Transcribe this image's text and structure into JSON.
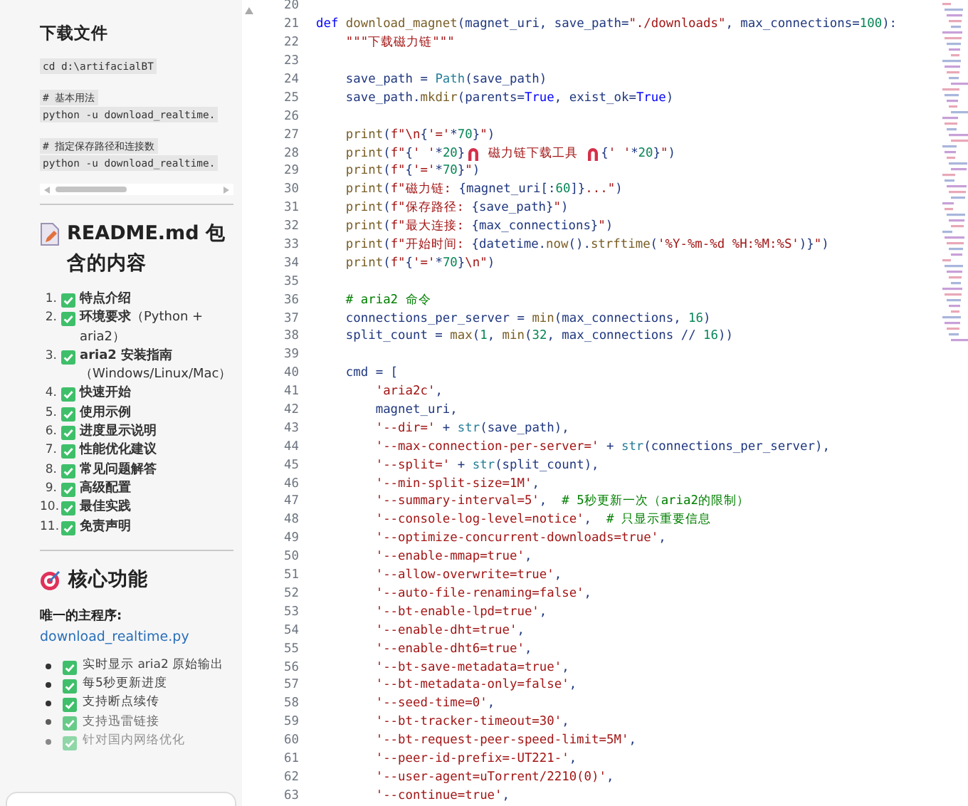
{
  "sidebar": {
    "download_heading": "下载文件",
    "code_blocks": [
      {
        "lines": [
          "cd d:\\artifacialBT"
        ]
      },
      {
        "lines": [
          "# 基本用法",
          "python -u download_realtime."
        ]
      },
      {
        "lines": [
          "# 指定保存路径和连接数",
          "python -u download_realtime."
        ]
      }
    ],
    "readme_heading": "README.md 包含的内容",
    "contents": [
      {
        "number": "1.",
        "text": "**特点介绍**"
      },
      {
        "number": "2.",
        "text": "**环境要求**（Python + aria2）"
      },
      {
        "number": "3.",
        "text": "**aria2 安装指南**（Windows/Linux/Mac）"
      },
      {
        "number": "4.",
        "text": "**快速开始**"
      },
      {
        "number": "5.",
        "text": "**使用示例**"
      },
      {
        "number": "6.",
        "text": "**进度显示说明**"
      },
      {
        "number": "7.",
        "text": "**性能优化建议**"
      },
      {
        "number": "8.",
        "text": "**常见问题解答**"
      },
      {
        "number": "9.",
        "text": "**高级配置**"
      },
      {
        "number": "10.",
        "text": "**最佳实践**"
      },
      {
        "number": "11.",
        "text": "**免责声明**"
      }
    ],
    "core_heading": "核心功能",
    "main_program_label": "唯一的主程序:",
    "main_program_link": "download_realtime.py",
    "features": [
      "实时显示 aria2 原始输出",
      "每5秒更新进度",
      "支持断点续传",
      "支持迅雷链接",
      "针对国内网络优化"
    ]
  },
  "editor": {
    "lines": [
      {
        "number": "20"
      },
      {
        "number": "21",
        "tokens": [
          {
            "kind": "kw",
            "text": "def "
          },
          {
            "kind": "fn",
            "text": "download_magnet"
          },
          {
            "kind": "pl",
            "text": "(magnet_uri, save_path="
          },
          {
            "kind": "str",
            "text": "\"./downloads\""
          },
          {
            "kind": "pl",
            "text": ", max_connections="
          },
          {
            "kind": "num",
            "text": "100"
          },
          {
            "kind": "pl",
            "text": "):"
          }
        ]
      },
      {
        "number": "22",
        "tokens": [
          {
            "kind": "str",
            "text": "    \"\"\"下载磁力链\"\"\""
          }
        ]
      },
      {
        "number": "23"
      },
      {
        "number": "24",
        "tokens": [
          {
            "kind": "pl",
            "text": "    save_path = "
          },
          {
            "kind": "bi",
            "text": "Path"
          },
          {
            "kind": "pl",
            "text": "(save_path)"
          }
        ]
      },
      {
        "number": "25",
        "tokens": [
          {
            "kind": "pl",
            "text": "    save_path."
          },
          {
            "kind": "fn",
            "text": "mkdir"
          },
          {
            "kind": "pl",
            "text": "(parents="
          },
          {
            "kind": "kw",
            "text": "True"
          },
          {
            "kind": "pl",
            "text": ", exist_ok="
          },
          {
            "kind": "kw",
            "text": "True"
          },
          {
            "kind": "pl",
            "text": ")"
          }
        ]
      },
      {
        "number": "26"
      },
      {
        "number": "27",
        "tokens": [
          {
            "kind": "fn",
            "text": "    print"
          },
          {
            "kind": "pl",
            "text": "("
          },
          {
            "kind": "str",
            "text": "f\"\\n"
          },
          {
            "kind": "pl",
            "text": "{"
          },
          {
            "kind": "str",
            "text": "'='"
          },
          {
            "kind": "pl",
            "text": "*"
          },
          {
            "kind": "num",
            "text": "70"
          },
          {
            "kind": "pl",
            "text": "}"
          },
          {
            "kind": "str",
            "text": "\""
          },
          {
            "kind": "pl",
            "text": ")"
          }
        ]
      },
      {
        "number": "28",
        "tokens": [
          {
            "kind": "fn",
            "text": "    print"
          },
          {
            "kind": "pl",
            "text": "("
          },
          {
            "kind": "str",
            "text": "f\""
          },
          {
            "kind": "pl",
            "text": "{"
          },
          {
            "kind": "str",
            "text": "' '"
          },
          {
            "kind": "pl",
            "text": "*"
          },
          {
            "kind": "num",
            "text": "20"
          },
          {
            "kind": "pl",
            "text": "}"
          },
          {
            "kind": "icon"
          },
          {
            "kind": "str",
            "text": " 磁力链下载工具 "
          },
          {
            "kind": "icon"
          },
          {
            "kind": "pl",
            "text": "{"
          },
          {
            "kind": "str",
            "text": "' '"
          },
          {
            "kind": "pl",
            "text": "*"
          },
          {
            "kind": "num",
            "text": "20"
          },
          {
            "kind": "pl",
            "text": "}"
          },
          {
            "kind": "str",
            "text": "\""
          },
          {
            "kind": "pl",
            "text": ")"
          }
        ]
      },
      {
        "number": "29",
        "tokens": [
          {
            "kind": "fn",
            "text": "    print"
          },
          {
            "kind": "pl",
            "text": "("
          },
          {
            "kind": "str",
            "text": "f\""
          },
          {
            "kind": "pl",
            "text": "{"
          },
          {
            "kind": "str",
            "text": "'='"
          },
          {
            "kind": "pl",
            "text": "*"
          },
          {
            "kind": "num",
            "text": "70"
          },
          {
            "kind": "pl",
            "text": "}"
          },
          {
            "kind": "str",
            "text": "\""
          },
          {
            "kind": "pl",
            "text": ")"
          }
        ]
      },
      {
        "number": "30",
        "tokens": [
          {
            "kind": "fn",
            "text": "    print"
          },
          {
            "kind": "pl",
            "text": "("
          },
          {
            "kind": "str",
            "text": "f\"磁力链: "
          },
          {
            "kind": "pl",
            "text": "{magnet_uri[:"
          },
          {
            "kind": "num",
            "text": "60"
          },
          {
            "kind": "pl",
            "text": "]}"
          },
          {
            "kind": "str",
            "text": "...\""
          },
          {
            "kind": "pl",
            "text": ")"
          }
        ]
      },
      {
        "number": "31",
        "tokens": [
          {
            "kind": "fn",
            "text": "    print"
          },
          {
            "kind": "pl",
            "text": "("
          },
          {
            "kind": "str",
            "text": "f\"保存路径: "
          },
          {
            "kind": "pl",
            "text": "{save_path}"
          },
          {
            "kind": "str",
            "text": "\""
          },
          {
            "kind": "pl",
            "text": ")"
          }
        ]
      },
      {
        "number": "32",
        "tokens": [
          {
            "kind": "fn",
            "text": "    print"
          },
          {
            "kind": "pl",
            "text": "("
          },
          {
            "kind": "str",
            "text": "f\"最大连接: "
          },
          {
            "kind": "pl",
            "text": "{max_connections}"
          },
          {
            "kind": "str",
            "text": "\""
          },
          {
            "kind": "pl",
            "text": ")"
          }
        ]
      },
      {
        "number": "33",
        "tokens": [
          {
            "kind": "fn",
            "text": "    print"
          },
          {
            "kind": "pl",
            "text": "("
          },
          {
            "kind": "str",
            "text": "f\"开始时间: "
          },
          {
            "kind": "pl",
            "text": "{datetime."
          },
          {
            "kind": "fn",
            "text": "now"
          },
          {
            "kind": "pl",
            "text": "()."
          },
          {
            "kind": "fn",
            "text": "strftime"
          },
          {
            "kind": "pl",
            "text": "("
          },
          {
            "kind": "str",
            "text": "'%Y-%m-%d %H:%M:%S'"
          },
          {
            "kind": "pl",
            "text": ")}"
          },
          {
            "kind": "str",
            "text": "\""
          },
          {
            "kind": "pl",
            "text": ")"
          }
        ]
      },
      {
        "number": "34",
        "tokens": [
          {
            "kind": "fn",
            "text": "    print"
          },
          {
            "kind": "pl",
            "text": "("
          },
          {
            "kind": "str",
            "text": "f\""
          },
          {
            "kind": "pl",
            "text": "{"
          },
          {
            "kind": "str",
            "text": "'='"
          },
          {
            "kind": "pl",
            "text": "*"
          },
          {
            "kind": "num",
            "text": "70"
          },
          {
            "kind": "pl",
            "text": "}"
          },
          {
            "kind": "str",
            "text": "\\n\""
          },
          {
            "kind": "pl",
            "text": ")"
          }
        ]
      },
      {
        "number": "35"
      },
      {
        "number": "36",
        "tokens": [
          {
            "kind": "cm",
            "text": "    # aria2 命令"
          }
        ]
      },
      {
        "number": "37",
        "tokens": [
          {
            "kind": "pl",
            "text": "    connections_per_server = "
          },
          {
            "kind": "fn",
            "text": "min"
          },
          {
            "kind": "pl",
            "text": "(max_connections, "
          },
          {
            "kind": "num",
            "text": "16"
          },
          {
            "kind": "pl",
            "text": ")"
          }
        ]
      },
      {
        "number": "38",
        "tokens": [
          {
            "kind": "pl",
            "text": "    split_count = "
          },
          {
            "kind": "fn",
            "text": "max"
          },
          {
            "kind": "pl",
            "text": "("
          },
          {
            "kind": "num",
            "text": "1"
          },
          {
            "kind": "pl",
            "text": ", "
          },
          {
            "kind": "fn",
            "text": "min"
          },
          {
            "kind": "pl",
            "text": "("
          },
          {
            "kind": "num",
            "text": "32"
          },
          {
            "kind": "pl",
            "text": ", max_connections // "
          },
          {
            "kind": "num",
            "text": "16"
          },
          {
            "kind": "pl",
            "text": "))"
          }
        ]
      },
      {
        "number": "39"
      },
      {
        "number": "40",
        "tokens": [
          {
            "kind": "pl",
            "text": "    cmd = ["
          }
        ]
      },
      {
        "number": "41",
        "tokens": [
          {
            "kind": "str",
            "text": "        'aria2c'"
          },
          {
            "kind": "pl",
            "text": ","
          }
        ]
      },
      {
        "number": "42",
        "tokens": [
          {
            "kind": "pl",
            "text": "        magnet_uri,"
          }
        ]
      },
      {
        "number": "43",
        "tokens": [
          {
            "kind": "str",
            "text": "        '--dir='"
          },
          {
            "kind": "pl",
            "text": " + "
          },
          {
            "kind": "bi",
            "text": "str"
          },
          {
            "kind": "pl",
            "text": "(save_path),"
          }
        ]
      },
      {
        "number": "44",
        "tokens": [
          {
            "kind": "str",
            "text": "        '--max-connection-per-server='"
          },
          {
            "kind": "pl",
            "text": " + "
          },
          {
            "kind": "bi",
            "text": "str"
          },
          {
            "kind": "pl",
            "text": "(connections_per_server),"
          }
        ]
      },
      {
        "number": "45",
        "tokens": [
          {
            "kind": "str",
            "text": "        '--split='"
          },
          {
            "kind": "pl",
            "text": " + "
          },
          {
            "kind": "bi",
            "text": "str"
          },
          {
            "kind": "pl",
            "text": "(split_count),"
          }
        ]
      },
      {
        "number": "46",
        "tokens": [
          {
            "kind": "str",
            "text": "        '--min-split-size=1M'"
          },
          {
            "kind": "pl",
            "text": ","
          }
        ]
      },
      {
        "number": "47",
        "tokens": [
          {
            "kind": "str",
            "text": "        '--summary-interval=5'"
          },
          {
            "kind": "pl",
            "text": ",  "
          },
          {
            "kind": "cm",
            "text": "# 5秒更新一次（aria2的限制）"
          }
        ]
      },
      {
        "number": "48",
        "tokens": [
          {
            "kind": "str",
            "text": "        '--console-log-level=notice'"
          },
          {
            "kind": "pl",
            "text": ",  "
          },
          {
            "kind": "cm",
            "text": "# 只显示重要信息"
          }
        ]
      },
      {
        "number": "49",
        "tokens": [
          {
            "kind": "str",
            "text": "        '--optimize-concurrent-downloads=true'"
          },
          {
            "kind": "pl",
            "text": ","
          }
        ]
      },
      {
        "number": "50",
        "tokens": [
          {
            "kind": "str",
            "text": "        '--enable-mmap=true'"
          },
          {
            "kind": "pl",
            "text": ","
          }
        ]
      },
      {
        "number": "51",
        "tokens": [
          {
            "kind": "str",
            "text": "        '--allow-overwrite=true'"
          },
          {
            "kind": "pl",
            "text": ","
          }
        ]
      },
      {
        "number": "52",
        "tokens": [
          {
            "kind": "str",
            "text": "        '--auto-file-renaming=false'"
          },
          {
            "kind": "pl",
            "text": ","
          }
        ]
      },
      {
        "number": "53",
        "tokens": [
          {
            "kind": "str",
            "text": "        '--bt-enable-lpd=true'"
          },
          {
            "kind": "pl",
            "text": ","
          }
        ]
      },
      {
        "number": "54",
        "tokens": [
          {
            "kind": "str",
            "text": "        '--enable-dht=true'"
          },
          {
            "kind": "pl",
            "text": ","
          }
        ]
      },
      {
        "number": "55",
        "tokens": [
          {
            "kind": "str",
            "text": "        '--enable-dht6=true'"
          },
          {
            "kind": "pl",
            "text": ","
          }
        ]
      },
      {
        "number": "56",
        "tokens": [
          {
            "kind": "str",
            "text": "        '--bt-save-metadata=true'"
          },
          {
            "kind": "pl",
            "text": ","
          }
        ]
      },
      {
        "number": "57",
        "tokens": [
          {
            "kind": "str",
            "text": "        '--bt-metadata-only=false'"
          },
          {
            "kind": "pl",
            "text": ","
          }
        ]
      },
      {
        "number": "58",
        "tokens": [
          {
            "kind": "str",
            "text": "        '--seed-time=0'"
          },
          {
            "kind": "pl",
            "text": ","
          }
        ]
      },
      {
        "number": "59",
        "tokens": [
          {
            "kind": "str",
            "text": "        '--bt-tracker-timeout=30'"
          },
          {
            "kind": "pl",
            "text": ","
          }
        ]
      },
      {
        "number": "60",
        "tokens": [
          {
            "kind": "str",
            "text": "        '--bt-request-peer-speed-limit=5M'"
          },
          {
            "kind": "pl",
            "text": ","
          }
        ]
      },
      {
        "number": "61",
        "tokens": [
          {
            "kind": "str",
            "text": "        '--peer-id-prefix=-UT221-'"
          },
          {
            "kind": "pl",
            "text": ","
          }
        ]
      },
      {
        "number": "62",
        "tokens": [
          {
            "kind": "str",
            "text": "        '--user-agent=uTorrent/2210(0)'"
          },
          {
            "kind": "pl",
            "text": ","
          }
        ]
      },
      {
        "number": "63",
        "tokens": [
          {
            "kind": "str",
            "text": "        '--continue=true'"
          },
          {
            "kind": "pl",
            "text": ","
          }
        ]
      }
    ]
  }
}
